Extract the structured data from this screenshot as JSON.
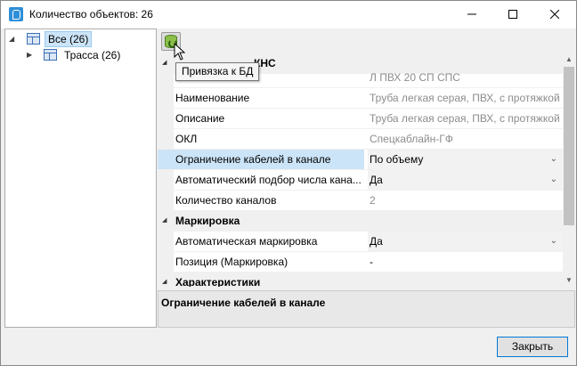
{
  "window": {
    "title": "Количество объектов: 26",
    "controls": {
      "minimize": "—",
      "maximize": "☐",
      "close": "✕"
    }
  },
  "tree": {
    "items": [
      {
        "label": "Все (26)",
        "expanded": true,
        "selected": true
      },
      {
        "label": "Трасса (26)",
        "expanded": false,
        "selected": false
      }
    ]
  },
  "toolbar": {
    "bind_db_tooltip": "Привязка к БД"
  },
  "grid": {
    "category_general_partial": "КНС",
    "rows": {
      "code": {
        "value": "Л ПВХ 20 СП СПС"
      },
      "name": {
        "label": "Наименование",
        "value": "Труба легкая серая, ПВХ, с протяжкой"
      },
      "description": {
        "label": "Описание",
        "value": "Труба легкая серая, ПВХ, с протяжкой"
      },
      "okl": {
        "label": "ОКЛ",
        "value": "Спецкаблайн-ГФ"
      },
      "cable_limit": {
        "label": "Ограничение кабелей в канале",
        "value": "По объему"
      },
      "auto_channels": {
        "label": "Автоматический подбор числа кана...",
        "value": "Да"
      },
      "channel_count": {
        "label": "Количество каналов",
        "value": "2"
      },
      "marking_category": "Маркировка",
      "auto_marking": {
        "label": "Автоматическая маркировка",
        "value": "Да"
      },
      "position": {
        "label": "Позиция (Маркировка)",
        "value": "-"
      },
      "characteristics_category": "Характеристики"
    }
  },
  "description_panel": {
    "title": "Ограничение кабелей в канале"
  },
  "footer": {
    "close_label": "Закрыть"
  }
}
